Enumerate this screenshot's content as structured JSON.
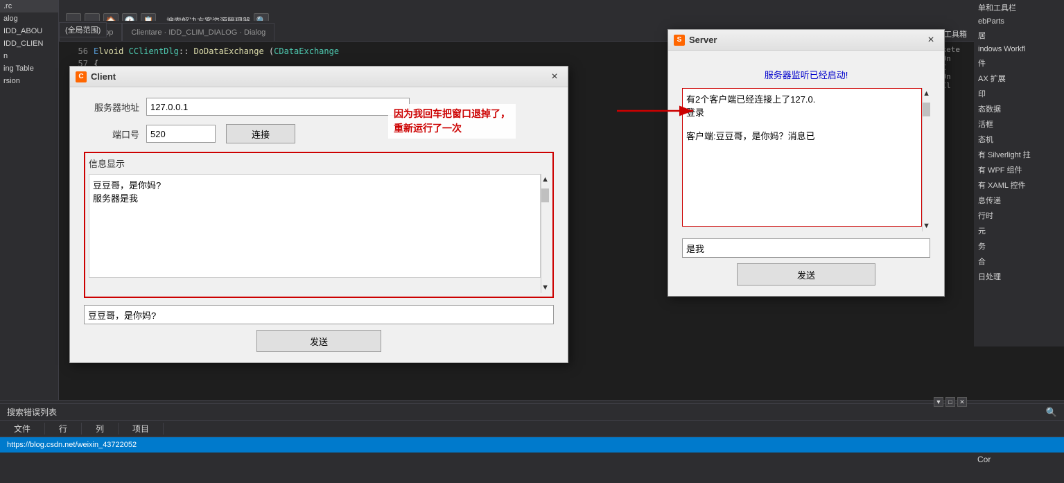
{
  "ide": {
    "background_color": "#1e1e1e",
    "tabs": [
      {
        "label": "ClientDlg.cpp",
        "active": true
      },
      {
        "label": "Clientare · IDD_CLIM_DIALOG · Dialog",
        "active": false
      }
    ],
    "scope": "(全局范围)",
    "search_placeholder": "搜索工具箱",
    "toolbar_items": [
      "←",
      "→",
      "🏠",
      "🕐",
      "📋"
    ],
    "solution_explorer": "搜索解决方案资源管理器",
    "code_lines": [
      {
        "num": "56",
        "content": "Elvoid CClientDlg::DoDataExchange(CDataExchange"
      },
      {
        "num": "57",
        "content": "{"
      }
    ]
  },
  "sidebar_left": {
    "items": [
      ".rc",
      "alog",
      "IDD_ABOU",
      "IDD_CLIEN",
      "n",
      "ing Table",
      "rsion"
    ]
  },
  "sidebar_right": {
    "items": [
      "单和工具栏",
      "ebParts",
      "居",
      "indows Workfl",
      "件",
      "AX 扩展",
      "印",
      "态数据",
      "活框",
      "态机",
      "有 Silverlight 拄",
      "有 WPF 组件",
      "有 XAML 控件",
      "息传递",
      "行时",
      "元",
      "务",
      "合",
      "日处理"
    ]
  },
  "client_dialog": {
    "title": "Client",
    "icon_color": "#ff6600",
    "close_label": "×",
    "server_address_label": "服务器地址",
    "server_address_value": "127.0.0.1",
    "port_label": "端口号",
    "port_value": "520",
    "connect_label": "连接",
    "info_label": "信息显示",
    "info_content": "豆豆哥，是你妈?\n服务器是我",
    "send_input_value": "豆豆哥，是你妈?",
    "send_label": "发送"
  },
  "server_dialog": {
    "title": "Server",
    "icon_color": "#ff6600",
    "close_label": "×",
    "status_text": "服务器监听已经启动!",
    "info_content": "有2个客户端已经连接上了127.0.\n登录\n\n客户端:豆豆哥，是你妈？消息已",
    "send_input_value": "是我",
    "send_label": "发送"
  },
  "annotation": {
    "text_line1": "因为我回车把窗口退掉了，",
    "text_line2": "重新运行了一次",
    "color": "#cc0000"
  },
  "code_area": {
    "partial_lines": [
      "OnSockete",
      "Dlg::On",
      ":OnBnC",
      "Dlg::On",
      ":OnEnCl"
    ]
  },
  "bottom_bar": {
    "search_errors_label": "搜索错误列表",
    "col_file": "文件",
    "col_line": "行",
    "col_col": "列",
    "col_project": "项目",
    "url": "https://blog.csdn.net/weixin_43722052",
    "bottom_right_text": "Cor"
  }
}
